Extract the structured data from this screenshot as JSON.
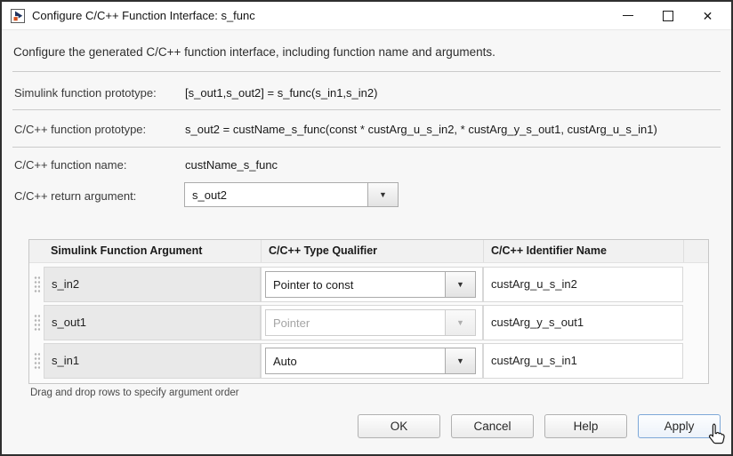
{
  "window": {
    "title": "Configure C/C++ Function Interface: s_func"
  },
  "description": "Configure the generated C/C++ function interface, including function name and arguments.",
  "fields": {
    "simulink_prototype": {
      "label": "Simulink function prototype:",
      "value": "[s_out1,s_out2] = s_func(s_in1,s_in2)"
    },
    "c_prototype": {
      "label": "C/C++ function prototype:",
      "value": "s_out2 = custName_s_func(const * custArg_u_s_in2, * custArg_y_s_out1, custArg_u_s_in1)"
    },
    "c_name": {
      "label": "C/C++ function name:",
      "value": "custName_s_func"
    },
    "return_argument": {
      "label": "C/C++ return argument:",
      "value": "s_out2"
    }
  },
  "table": {
    "headers": [
      "Simulink Function Argument",
      "C/C++ Type Qualifier",
      "C/C++ Identifier Name"
    ],
    "rows": [
      {
        "argument": "s_in2",
        "qualifier": "Pointer to const",
        "qualifier_enabled": true,
        "identifier": "custArg_u_s_in2"
      },
      {
        "argument": "s_out1",
        "qualifier": "Pointer",
        "qualifier_enabled": false,
        "identifier": "custArg_y_s_out1"
      },
      {
        "argument": "s_in1",
        "qualifier": "Auto",
        "qualifier_enabled": true,
        "identifier": "custArg_u_s_in1"
      }
    ],
    "hint": "Drag and drop rows to specify argument order"
  },
  "buttons": {
    "ok": "OK",
    "cancel": "Cancel",
    "help": "Help",
    "apply": "Apply"
  },
  "icons": {
    "dropdown": "▼",
    "close": "✕"
  },
  "colors": {
    "apply_accent_border": "#7ea8d8",
    "argument_cell_bg": "#e9e9e9",
    "header_bg": "#f1f1f1",
    "disabled_text": "#a4a4a4"
  }
}
